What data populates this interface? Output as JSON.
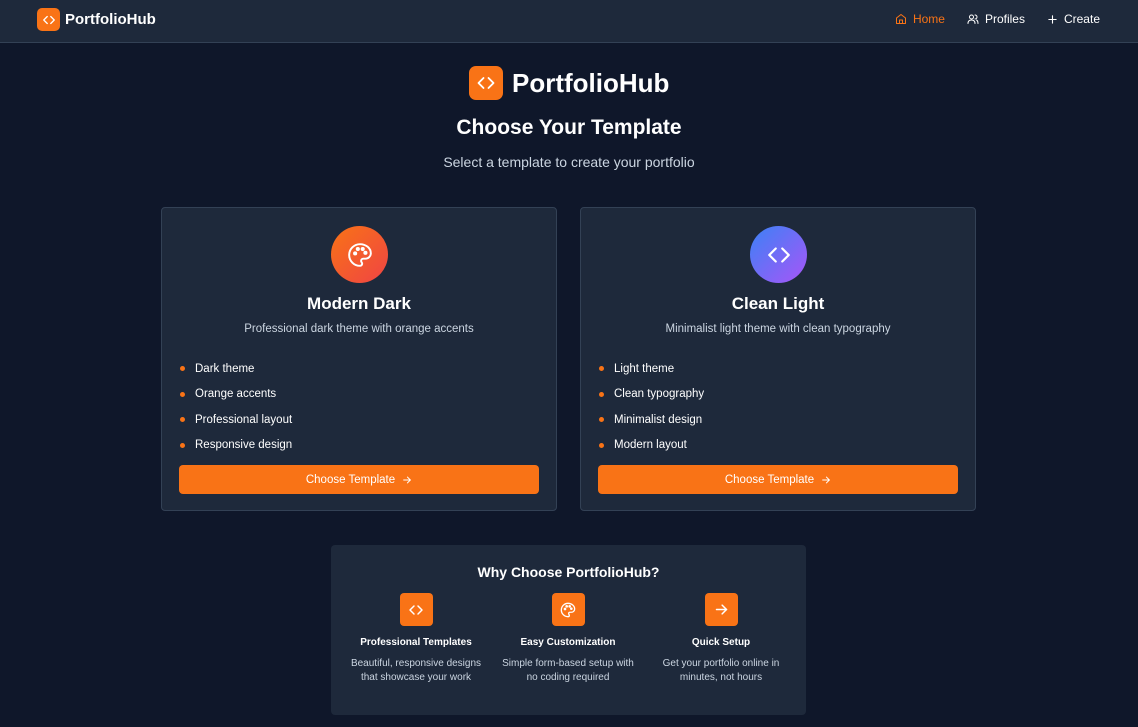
{
  "nav": {
    "brand": "PortfolioHub",
    "links": [
      {
        "label": "Home",
        "icon": "home-icon",
        "active": true
      },
      {
        "label": "Profiles",
        "icon": "users-icon",
        "active": false
      },
      {
        "label": "Create",
        "icon": "plus-icon",
        "active": false
      }
    ]
  },
  "hero": {
    "brand": "PortfolioHub",
    "title": "Choose Your Template",
    "subtitle": "Select a template to create your portfolio"
  },
  "templates": [
    {
      "icon": "palette-icon",
      "title": "Modern Dark",
      "description": "Professional dark theme with orange accents",
      "features": [
        "Dark theme",
        "Orange accents",
        "Professional layout",
        "Responsive design"
      ],
      "button": "Choose Template"
    },
    {
      "icon": "code-icon",
      "title": "Clean Light",
      "description": "Minimalist light theme with clean typography",
      "features": [
        "Light theme",
        "Clean typography",
        "Minimalist design",
        "Modern layout"
      ],
      "button": "Choose Template"
    }
  ],
  "why": {
    "title": "Why Choose PortfolioHub?",
    "items": [
      {
        "icon": "code-icon",
        "title": "Professional Templates",
        "description": "Beautiful, responsive designs that showcase your work"
      },
      {
        "icon": "palette-icon",
        "title": "Easy Customization",
        "description": "Simple form-based setup with no coding required"
      },
      {
        "icon": "arrow-right-icon",
        "title": "Quick Setup",
        "description": "Get your portfolio online in minutes, not hours"
      }
    ]
  },
  "colors": {
    "background": "#0f172a",
    "surface": "#1e293b",
    "accent": "#f97316",
    "muted_text": "#cbd5e1"
  }
}
